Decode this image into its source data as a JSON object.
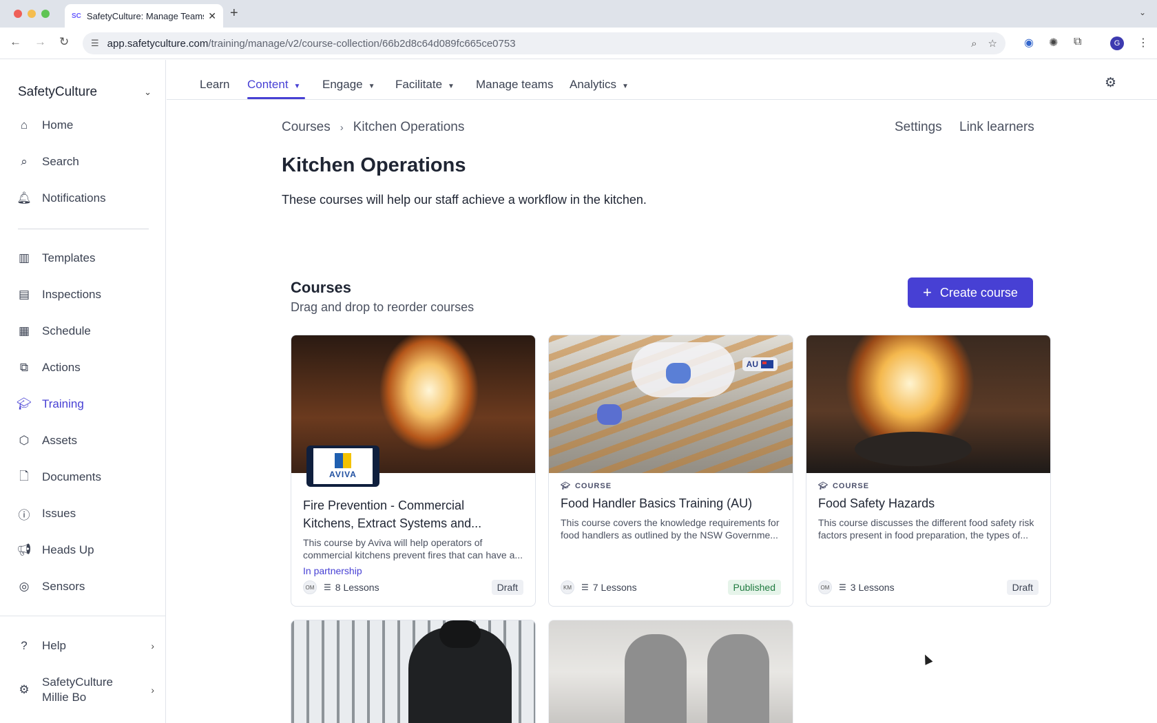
{
  "browser": {
    "tab_title": "SafetyCulture: Manage Teams",
    "favicon_text": "SC",
    "url_domain": "app.safetyculture.com",
    "url_path": "/training/manage/v2/course-collection/66b2d8c64d089fc665ce0753",
    "profile_initial": "G"
  },
  "sidebar": {
    "org_name": "SafetyCulture",
    "items": [
      {
        "label": "Home",
        "icon": "home-icon"
      },
      {
        "label": "Search",
        "icon": "search-icon"
      },
      {
        "label": "Notifications",
        "icon": "bell-icon"
      },
      {
        "label": "Templates",
        "icon": "templates-icon"
      },
      {
        "label": "Inspections",
        "icon": "clipboard-icon"
      },
      {
        "label": "Schedule",
        "icon": "calendar-icon"
      },
      {
        "label": "Actions",
        "icon": "actions-icon"
      },
      {
        "label": "Training",
        "icon": "graduation-cap-icon"
      },
      {
        "label": "Assets",
        "icon": "cube-icon"
      },
      {
        "label": "Documents",
        "icon": "document-icon"
      },
      {
        "label": "Issues",
        "icon": "alert-icon"
      },
      {
        "label": "Heads Up",
        "icon": "megaphone-icon"
      },
      {
        "label": "Sensors",
        "icon": "sensor-icon"
      }
    ],
    "help_label": "Help",
    "account_line1": "SafetyCulture",
    "account_line2": "Millie Bo"
  },
  "topnav": {
    "items": [
      {
        "label": "Learn"
      },
      {
        "label": "Content"
      },
      {
        "label": "Engage"
      },
      {
        "label": "Facilitate"
      },
      {
        "label": "Manage teams"
      },
      {
        "label": "Analytics"
      }
    ],
    "active": "Content"
  },
  "header": {
    "breadcrumb_root": "Courses",
    "breadcrumb_current": "Kitchen Operations",
    "settings_link": "Settings",
    "link_learners": "Link learners",
    "title": "Kitchen Operations",
    "description": "These courses will help our staff achieve a workflow in the kitchen."
  },
  "courses_section": {
    "title": "Courses",
    "subtitle": "Drag and drop to reorder courses",
    "create_label": "Create course"
  },
  "cards": [
    {
      "kind": "",
      "title_line1": "Fire Prevention - Commercial",
      "title_line2": "Kitchens, Extract Systems and...",
      "desc_line1": "This course by Aviva will help operators of",
      "desc_line2": "commercial kitchens prevent fires that can have a...",
      "partner": "In partnership",
      "partner_logo_text": "AVIVA",
      "author": "OM",
      "lessons": "8 Lessons",
      "status": "Draft"
    },
    {
      "kind": "COURSE",
      "title": "Food Handler Basics Training (AU)",
      "desc_line1": "This course covers the knowledge requirements for",
      "desc_line2": "food handlers as outlined by the NSW Governme...",
      "badge": "AU",
      "author": "KM",
      "lessons": "7 Lessons",
      "status": "Published"
    },
    {
      "kind": "COURSE",
      "title": "Food Safety Hazards",
      "desc_line1": "This course discusses the different food safety risk",
      "desc_line2": "factors present in food preparation, the types of...",
      "author": "OM",
      "lessons": "3 Lessons",
      "status": "Draft"
    }
  ]
}
